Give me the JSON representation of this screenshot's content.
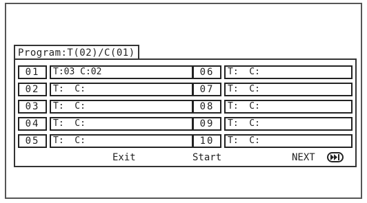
{
  "title": "Program:T(02)/C(01)",
  "left_entries": [
    {
      "num": "01",
      "value": "T:03 C:02"
    },
    {
      "num": "02",
      "value": "T:  C:"
    },
    {
      "num": "03",
      "value": "T:  C:"
    },
    {
      "num": "04",
      "value": "T:  C:"
    },
    {
      "num": "05",
      "value": "T:  C:"
    }
  ],
  "right_entries": [
    {
      "num": "06",
      "value": "T:  C:"
    },
    {
      "num": "07",
      "value": "T:  C:"
    },
    {
      "num": "08",
      "value": "T:  C:"
    },
    {
      "num": "09",
      "value": "T:  C:"
    },
    {
      "num": "10",
      "value": "T:  C:"
    }
  ],
  "footer": {
    "exit_label": "Exit",
    "start_label": "Start",
    "next_label": "NEXT",
    "next_icon": "fast-forward-icon"
  }
}
